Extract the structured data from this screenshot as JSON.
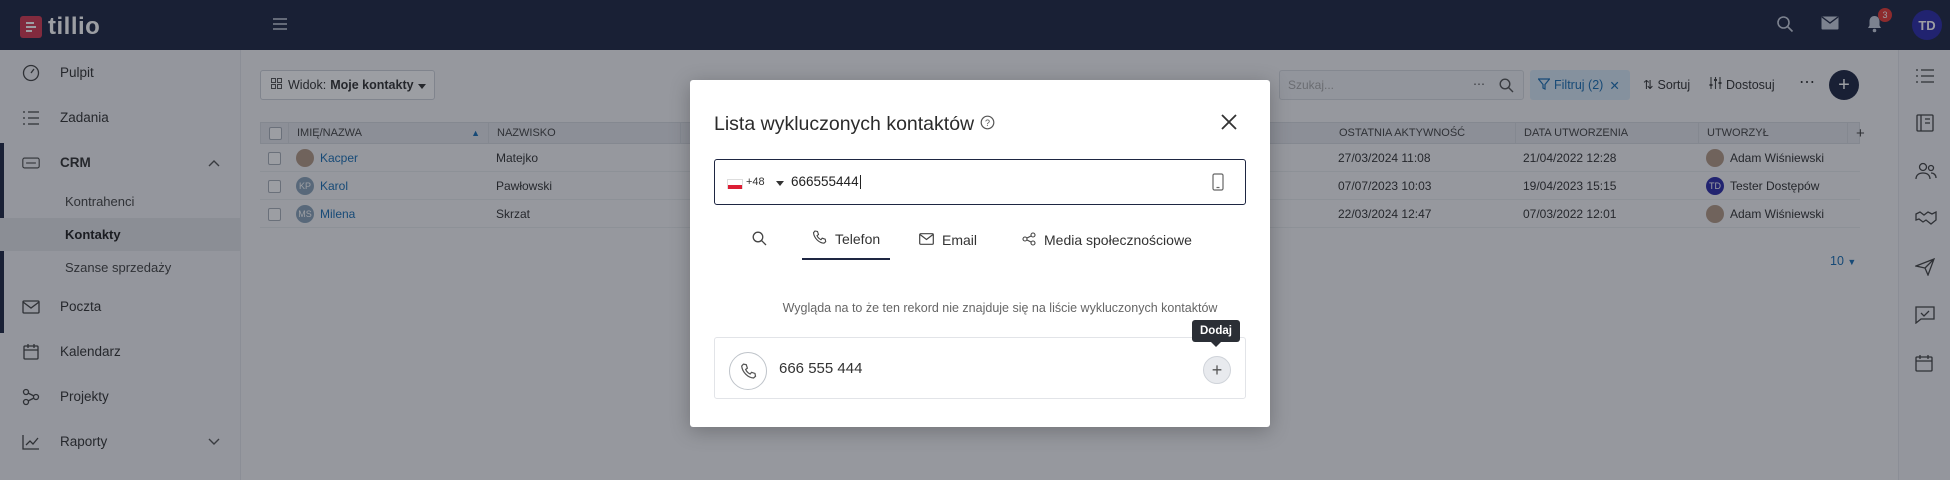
{
  "app": {
    "logo_text": "tillio",
    "avatar_initials": "TD",
    "notifications_count": "3"
  },
  "sidebar": {
    "items": [
      {
        "label": "Pulpit",
        "icon": "dashboard-icon"
      },
      {
        "label": "Zadania",
        "icon": "tasks-icon"
      },
      {
        "label": "CRM",
        "icon": "crm-icon"
      },
      {
        "label": "Poczta",
        "icon": "mail-icon"
      },
      {
        "label": "Kalendarz",
        "icon": "calendar-icon"
      },
      {
        "label": "Projekty",
        "icon": "projects-icon"
      },
      {
        "label": "Raporty",
        "icon": "reports-icon"
      }
    ],
    "crm_sub": [
      "Kontrahenci",
      "Kontakty",
      "Szanse sprzedaży"
    ]
  },
  "toolbar": {
    "view_prefix": "Widok:",
    "view_name": "Moje kontakty",
    "search_placeholder": "Szukaj...",
    "filter_label": "Filtruj (2)",
    "sort_label": "Sortuj",
    "customize_label": "Dostosuj"
  },
  "table": {
    "columns": [
      "IMIĘ/NAZWA",
      "NAZWISKO",
      "OSTATNIA AKTYWNOŚĆ",
      "DATA UTWORZENIA",
      "UTWORZYŁ"
    ],
    "rows": [
      {
        "avatar": "",
        "name": "Kacper",
        "surname": "Matejko",
        "last_activity": "27/03/2024 11:08",
        "created": "21/04/2022 12:28",
        "creator_avatar": "",
        "creator": "Adam Wiśniewski"
      },
      {
        "avatar": "KP",
        "name": "Karol",
        "surname": "Pawłowski",
        "last_activity": "07/07/2023 10:03",
        "created": "19/04/2023 15:15",
        "creator_avatar": "TD",
        "creator": "Tester Dostępów"
      },
      {
        "avatar": "MS",
        "name": "Milena",
        "surname": "Skrzat",
        "last_activity": "22/03/2024 12:47",
        "created": "07/03/2022 12:01",
        "creator_avatar": "",
        "creator": "Adam Wiśniewski"
      }
    ],
    "page_size": "10"
  },
  "modal": {
    "title": "Lista wykluczonych kontaktów",
    "country_code": "+48",
    "phone_value": "666555444",
    "tabs": [
      "Telefon",
      "Email",
      "Media społecznościowe"
    ],
    "empty_message": "Wygląda na to że ten rekord nie znajduje się na liście wykluczonych kontaktów",
    "result_number": "666 555 444",
    "tooltip": "Dodaj"
  }
}
